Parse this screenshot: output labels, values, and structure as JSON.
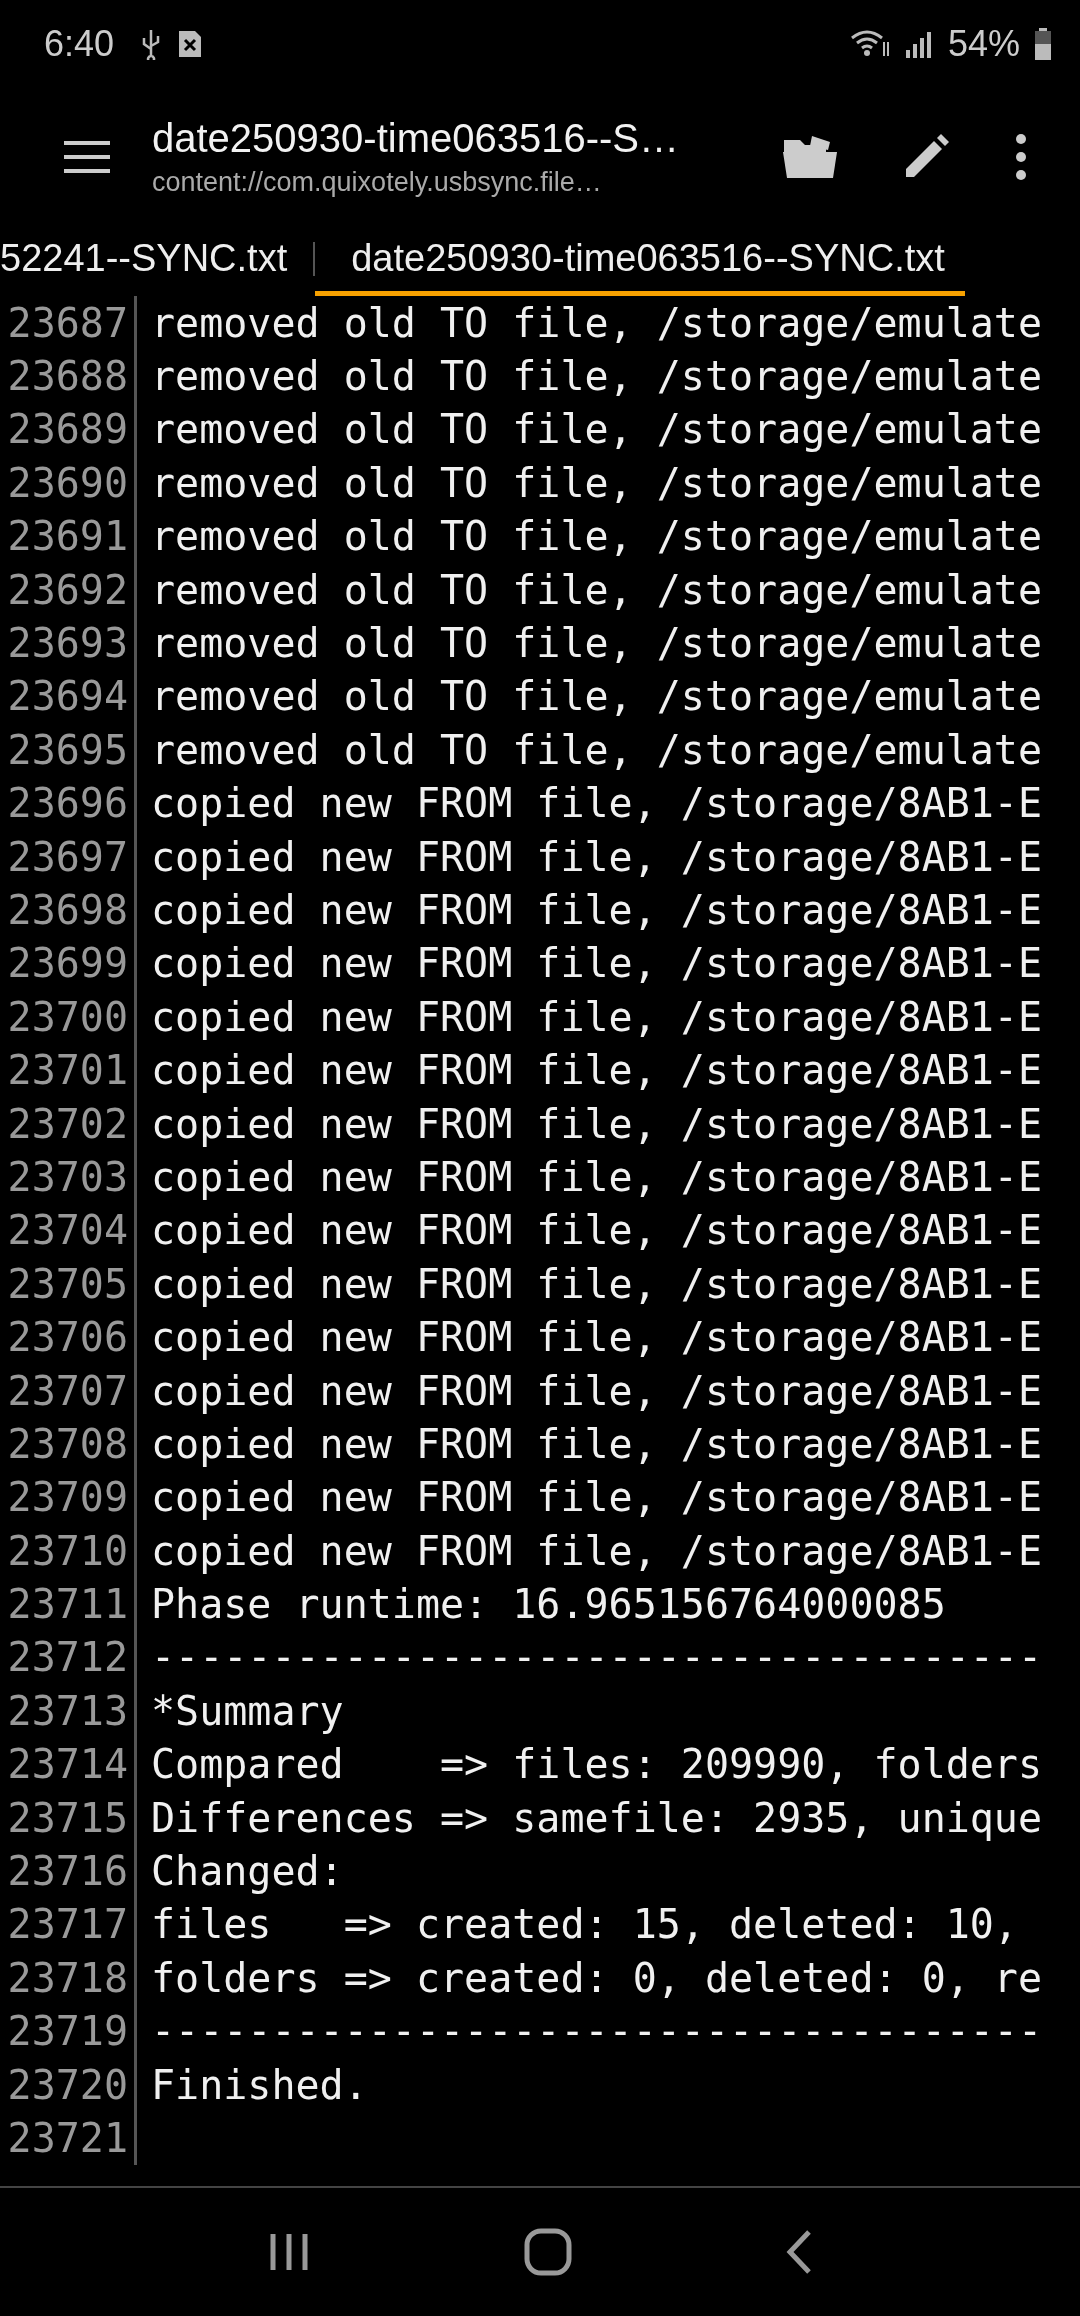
{
  "status_bar": {
    "time": "6:40",
    "battery": "54%"
  },
  "toolbar": {
    "title": "date250930-time063516--S…",
    "subtitle": "content://com.quixotely.usbsync.file…"
  },
  "tabs": [
    {
      "label": "52241--SYNC.txt",
      "selected": false
    },
    {
      "label": "date250930-time063516--SYNC.txt",
      "selected": true
    }
  ],
  "lines": [
    {
      "number": "23687",
      "text": "removed old TO file, /storage/emulate"
    },
    {
      "number": "23688",
      "text": "removed old TO file, /storage/emulate"
    },
    {
      "number": "23689",
      "text": "removed old TO file, /storage/emulate"
    },
    {
      "number": "23690",
      "text": "removed old TO file, /storage/emulate"
    },
    {
      "number": "23691",
      "text": "removed old TO file, /storage/emulate"
    },
    {
      "number": "23692",
      "text": "removed old TO file, /storage/emulate"
    },
    {
      "number": "23693",
      "text": "removed old TO file, /storage/emulate"
    },
    {
      "number": "23694",
      "text": "removed old TO file, /storage/emulate"
    },
    {
      "number": "23695",
      "text": "removed old TO file, /storage/emulate"
    },
    {
      "number": "23696",
      "text": "copied new FROM file, /storage/8AB1-E"
    },
    {
      "number": "23697",
      "text": "copied new FROM file, /storage/8AB1-E"
    },
    {
      "number": "23698",
      "text": "copied new FROM file, /storage/8AB1-E"
    },
    {
      "number": "23699",
      "text": "copied new FROM file, /storage/8AB1-E"
    },
    {
      "number": "23700",
      "text": "copied new FROM file, /storage/8AB1-E"
    },
    {
      "number": "23701",
      "text": "copied new FROM file, /storage/8AB1-E"
    },
    {
      "number": "23702",
      "text": "copied new FROM file, /storage/8AB1-E"
    },
    {
      "number": "23703",
      "text": "copied new FROM file, /storage/8AB1-E"
    },
    {
      "number": "23704",
      "text": "copied new FROM file, /storage/8AB1-E"
    },
    {
      "number": "23705",
      "text": "copied new FROM file, /storage/8AB1-E"
    },
    {
      "number": "23706",
      "text": "copied new FROM file, /storage/8AB1-E"
    },
    {
      "number": "23707",
      "text": "copied new FROM file, /storage/8AB1-E"
    },
    {
      "number": "23708",
      "text": "copied new FROM file, /storage/8AB1-E"
    },
    {
      "number": "23709",
      "text": "copied new FROM file, /storage/8AB1-E"
    },
    {
      "number": "23710",
      "text": "copied new FROM file, /storage/8AB1-E"
    },
    {
      "number": "23711",
      "text": "Phase runtime: 16.965156764000085"
    },
    {
      "number": "23712",
      "text": "-------------------------------------"
    },
    {
      "number": "23713",
      "text": "*Summary"
    },
    {
      "number": "23714",
      "text": "Compared    => files: 209990, folders"
    },
    {
      "number": "23715",
      "text": "Differences => samefile: 2935, unique"
    },
    {
      "number": "23716",
      "text": "Changed:"
    },
    {
      "number": "23717",
      "text": "files   => created: 15, deleted: 10,"
    },
    {
      "number": "23718",
      "text": "folders => created: 0, deleted: 0, re"
    },
    {
      "number": "23719",
      "text": "-------------------------------------"
    },
    {
      "number": "23720",
      "text": "Finished."
    },
    {
      "number": "23721"
    }
  ]
}
